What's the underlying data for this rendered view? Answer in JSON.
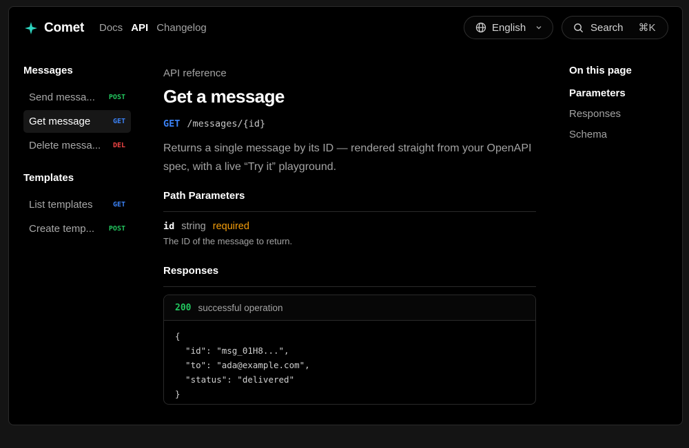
{
  "brand": {
    "name": "Comet",
    "accent": "#2dd4bf"
  },
  "topnav": {
    "items": [
      {
        "label": "Docs",
        "active": false
      },
      {
        "label": "API",
        "active": true
      },
      {
        "label": "Changelog",
        "active": false
      }
    ]
  },
  "language": {
    "label": "English"
  },
  "search": {
    "label": "Search",
    "shortcut": "⌘K"
  },
  "sidebar": {
    "groups": [
      {
        "title": "Messages",
        "items": [
          {
            "label": "Send messa...",
            "method": "POST"
          },
          {
            "label": "Get message",
            "method": "GET",
            "active": true
          },
          {
            "label": "Delete messa...",
            "method": "DEL"
          }
        ]
      },
      {
        "title": "Templates",
        "items": [
          {
            "label": "List templates",
            "method": "GET"
          },
          {
            "label": "Create temp...",
            "method": "POST"
          }
        ]
      }
    ]
  },
  "main": {
    "eyebrow": "API reference",
    "title": "Get a message",
    "method": "GET",
    "path": "/messages/{id}",
    "description": "Returns a single message by its ID — rendered straight from your OpenAPI spec, with a live “Try it” playground.",
    "path_params_title": "Path Parameters",
    "param": {
      "name": "id",
      "type": "string",
      "required": "required",
      "description": "The ID of the message to return."
    },
    "responses_title": "Responses",
    "response": {
      "code": "200",
      "message": "successful operation",
      "body": "{\n  \"id\": \"msg_01H8...\",\n  \"to\": \"ada@example.com\",\n  \"status\": \"delivered\"\n}"
    }
  },
  "toc": {
    "title": "On this page",
    "items": [
      {
        "label": "Parameters",
        "active": true
      },
      {
        "label": "Responses",
        "active": false
      },
      {
        "label": "Schema",
        "active": false
      }
    ]
  },
  "colors": {
    "post": "#22c55e",
    "get": "#3b82f6",
    "del": "#ef4444",
    "required": "#f59e0b"
  }
}
